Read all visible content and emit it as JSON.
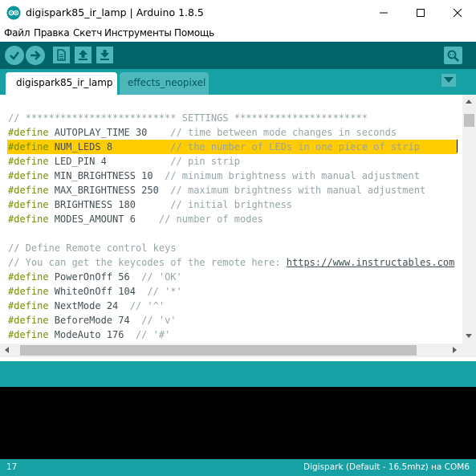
{
  "window": {
    "title": "digispark85_ir_lamp | Arduino 1.8.5",
    "accent": "#17a1a5",
    "toolbar_color": "#006468"
  },
  "menu": {
    "items": [
      "Файл",
      "Правка",
      "Скетч",
      "Инструменты",
      "Помощь"
    ]
  },
  "toolbar": {
    "buttons": [
      "verify-icon",
      "upload-icon",
      "new-icon",
      "open-icon",
      "save-icon"
    ],
    "serial_monitor": "serial-monitor-icon"
  },
  "tabs": [
    {
      "label": "digispark85_ir_lamp",
      "active": true
    },
    {
      "label": "effects_neopixel",
      "active": false
    }
  ],
  "code": {
    "l1": "// ************************** SETTINGS ***********************",
    "l2": {
      "kw": "#define",
      "rest": " AUTOPLAY_TIME 30    ",
      "comment": "// time between mode changes in seconds"
    },
    "l3": {
      "kw": "#define",
      "rest": " NUM_LEDS 8          ",
      "comment": "// the number of LEDs in one piece of strip"
    },
    "l4": {
      "kw": "#define",
      "rest": " LED_PIN 4           ",
      "comment": "// pin strip"
    },
    "l5": {
      "kw": "#define",
      "rest": " MIN_BRIGHTNESS 10  ",
      "comment": "// minimum brightness with manual adjustment"
    },
    "l6": {
      "kw": "#define",
      "rest": " MAX_BRIGHTNESS 250  ",
      "comment": "// maximum brightness with manual adjustment"
    },
    "l7": {
      "kw": "#define",
      "rest": " BRIGHTNESS 180      ",
      "comment": "// initial brightness"
    },
    "l8": {
      "kw": "#define",
      "rest": " MODES_AMOUNT 6    ",
      "comment": "// number of modes"
    },
    "l10": "// Define Remote control keys",
    "l11": {
      "comment": "// You can get the keycodes of the remote here: ",
      "link": "https://www.instructables.com"
    },
    "l12": {
      "kw": "#define",
      "rest": " PowerOnOff 56  ",
      "comment": "// 'OK'"
    },
    "l13": {
      "kw": "#define",
      "rest": " WhiteOnOff 104  ",
      "comment": "// '*'"
    },
    "l14": {
      "kw": "#define",
      "rest": " NextMode 24  ",
      "comment": "// '^'"
    },
    "l15": {
      "kw": "#define",
      "rest": " BeforeMode 74  ",
      "comment": "// 'v'"
    },
    "l16": {
      "kw": "#define",
      "rest": " ModeAuto 176  ",
      "comment": "// '#'"
    }
  },
  "status": {
    "line_number": "17",
    "board": "Digispark (Default - 16.5mhz) на COM6"
  }
}
